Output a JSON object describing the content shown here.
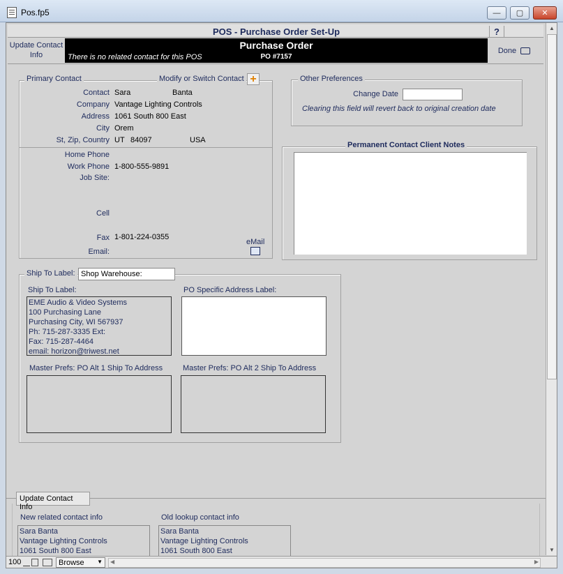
{
  "window": {
    "title": "Pos.fp5",
    "minimize": "—",
    "maximize": "▢",
    "close": "✕"
  },
  "header": {
    "title": "POS - Purchase Order Set-Up",
    "help": "?",
    "update_contact_info": "Update Contact Info",
    "po_title": "Purchase Order",
    "no_contact_msg": "There is no related contact for this POS",
    "po_number": "PO #7157",
    "done": "Done"
  },
  "primary_contact": {
    "title": "Primary Contact",
    "modify_label": "Modify or Switch Contact",
    "contact_label": "Contact",
    "first_name": "Sara",
    "last_name": "Banta",
    "company_label": "Company",
    "company": "Vantage Lighting Controls",
    "address_label": "Address",
    "address": "1061 South 800 East",
    "city_label": "City",
    "city": "Orem",
    "stzip_label": "St, Zip, Country",
    "state": "UT",
    "zip": "84097",
    "country": "USA",
    "home_phone_label": "Home Phone",
    "home_phone": "",
    "work_phone_label": "Work Phone",
    "work_phone": "1-800-555-9891",
    "job_site_label": "Job Site:",
    "cell_label": "Cell",
    "fax_label": "Fax",
    "fax": "1-801-224-0355",
    "email_label": "Email:",
    "email_button": "eMail"
  },
  "other_prefs": {
    "title": "Other Preferences",
    "change_date_label": "Change Date",
    "change_date_value": "",
    "note": "Clearing this field will revert back to original creation date"
  },
  "notes": {
    "title": "Permanent Contact Client Notes",
    "value": ""
  },
  "ship_to": {
    "title": "Ship To Label:",
    "select_value": "Shop Warehouse:",
    "label_title": "Ship To Label:",
    "label_lines": [
      "EME Audio & Video Systems",
      "100 Purchasing Lane",
      "Purchasing City, WI 567937",
      "Ph: 715-287-3335 Ext:",
      "Fax: 715-287-4464",
      "email: horizon@triwest.net"
    ],
    "po_specific_title": "PO Specific Address Label:",
    "alt1_title": "Master Prefs: PO Alt 1 Ship To Address",
    "alt2_title": "Master Prefs: PO Alt 2 Ship To Address"
  },
  "update_section": {
    "tab_label": "Update Contact Info",
    "new_title": "New related contact info",
    "new_lines": [
      "Sara Banta",
      "Vantage Lighting Controls",
      "1061 South 800 East"
    ],
    "old_title": "Old lookup contact info",
    "old_lines": [
      "Sara Banta",
      "Vantage Lighting Controls",
      "1061 South 800 East"
    ]
  },
  "statusbar": {
    "zoom": "100",
    "mode": "Browse"
  }
}
